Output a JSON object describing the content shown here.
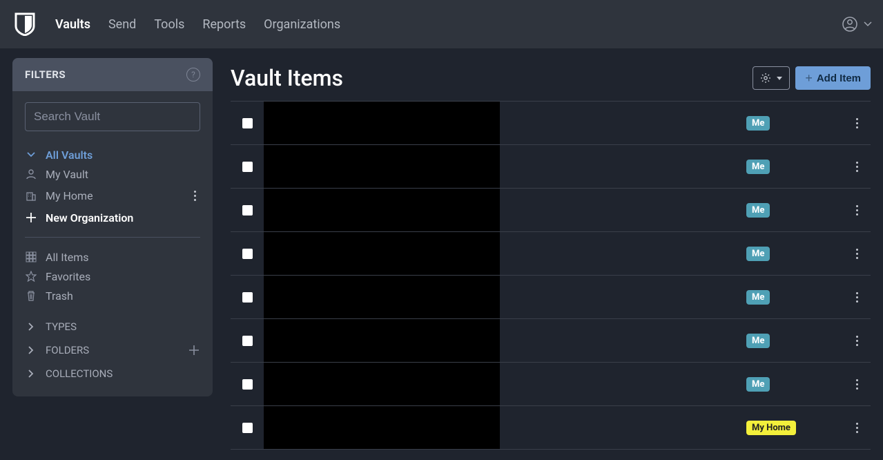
{
  "nav": {
    "items": [
      {
        "label": "Vaults",
        "active": true
      },
      {
        "label": "Send",
        "active": false
      },
      {
        "label": "Tools",
        "active": false
      },
      {
        "label": "Reports",
        "active": false
      },
      {
        "label": "Organizations",
        "active": false
      }
    ]
  },
  "sidebar": {
    "filters_title": "FILTERS",
    "search_placeholder": "Search Vault",
    "vaults": {
      "all_label": "All Vaults",
      "items": [
        {
          "label": "My Vault",
          "icon": "user"
        },
        {
          "label": "My Home",
          "icon": "org",
          "has_menu": true
        }
      ],
      "new_org_label": "New Organization"
    },
    "categories": [
      {
        "label": "All Items",
        "icon": "grid"
      },
      {
        "label": "Favorites",
        "icon": "star"
      },
      {
        "label": "Trash",
        "icon": "trash"
      }
    ],
    "sections": [
      {
        "label": "TYPES",
        "has_add": false
      },
      {
        "label": "FOLDERS",
        "has_add": true
      },
      {
        "label": "COLLECTIONS",
        "has_add": false
      }
    ]
  },
  "main": {
    "title": "Vault Items",
    "add_label": "Add Item",
    "rows": [
      {
        "owner_label": "Me",
        "owner_type": "me"
      },
      {
        "owner_label": "Me",
        "owner_type": "me"
      },
      {
        "owner_label": "Me",
        "owner_type": "me"
      },
      {
        "owner_label": "Me",
        "owner_type": "me"
      },
      {
        "owner_label": "Me",
        "owner_type": "me"
      },
      {
        "owner_label": "Me",
        "owner_type": "me"
      },
      {
        "owner_label": "Me",
        "owner_type": "me"
      },
      {
        "owner_label": "My Home",
        "owner_type": "home"
      }
    ]
  }
}
